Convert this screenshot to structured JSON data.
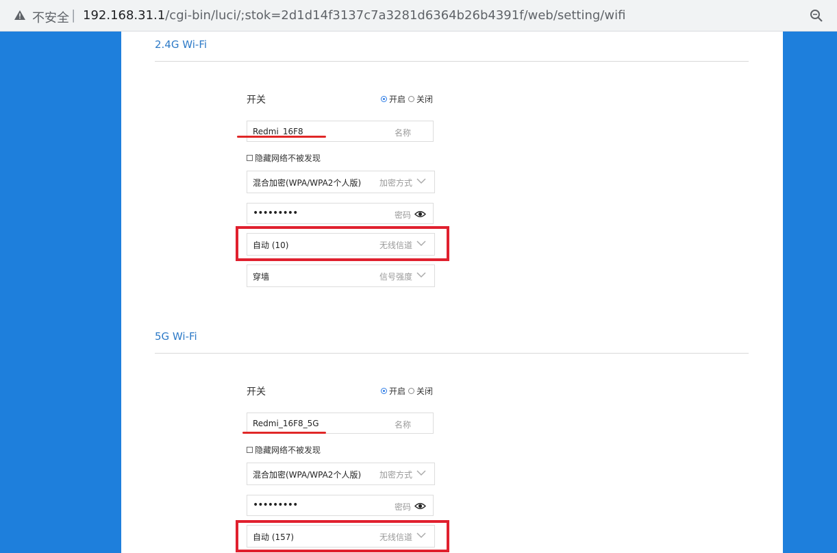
{
  "browser": {
    "insecure_label": "不安全",
    "url_host": "192.168.31.1",
    "url_path": "/cgi-bin/luci/;stok=2d1d14f3137c7a3281d6364b26b4391f/web/setting/wifi"
  },
  "wifi24": {
    "title": "2.4G Wi-Fi",
    "switch_label": "开关",
    "on_label": "开启",
    "off_label": "关闭",
    "name_value": "Redmi_16F8",
    "name_hint": "名称",
    "hide_label": "隐藏网络不被发现",
    "encryption_value": "混合加密(WPA/WPA2个人版)",
    "encryption_hint": "加密方式",
    "password_value": "•••••••••",
    "password_hint": "密码",
    "channel_value": "自动 (10)",
    "channel_hint": "无线信道",
    "signal_value": "穿墙",
    "signal_hint": "信号强度"
  },
  "wifi5": {
    "title": "5G Wi-Fi",
    "switch_label": "开关",
    "on_label": "开启",
    "off_label": "关闭",
    "name_value": "Redmi_16F8_5G",
    "name_hint": "名称",
    "hide_label": "隐藏网络不被发现",
    "encryption_value": "混合加密(WPA/WPA2个人版)",
    "encryption_hint": "加密方式",
    "password_value": "•••••••••",
    "password_hint": "密码",
    "channel_value": "自动 (157)",
    "channel_hint": "无线信道"
  },
  "colors": {
    "page_bg": "#1e7fdc",
    "accent": "#2d7ac7",
    "annotation": "#e0202e"
  }
}
